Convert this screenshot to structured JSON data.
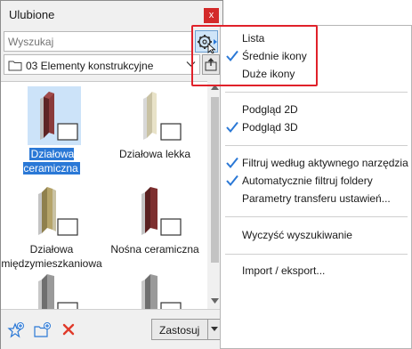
{
  "palette": {
    "title": "Ulubione",
    "close_glyph": "x",
    "search": {
      "placeholder": "Wyszukaj",
      "value": ""
    },
    "folder": {
      "selected": "03 Elementy konstrukcyjne"
    },
    "items": [
      {
        "label": "Działowa ceramiczna",
        "selected": true,
        "color": "#8a3b3b"
      },
      {
        "label": "Działowa lekka",
        "selected": false,
        "color": "#e8e2c8"
      },
      {
        "label": "Działowa międzymieszkaniowa",
        "label_line1": "Działowa",
        "label_line2": "międzymieszkaniowa",
        "selected": false,
        "color": "#b5a46a"
      },
      {
        "label": "Nośna ceramiczna",
        "selected": false,
        "color": "#7e2f2f"
      },
      {
        "label": "",
        "selected": false,
        "color": "#9a9a9a"
      },
      {
        "label": "",
        "selected": false,
        "color": "#9a9a9a"
      }
    ],
    "apply_label": "Zastosuj"
  },
  "menu": {
    "items": [
      {
        "label": "Lista",
        "checked": false
      },
      {
        "label": "Średnie ikony",
        "checked": true
      },
      {
        "label": "Duże ikony",
        "checked": false
      },
      {
        "label": "Podgląd 2D",
        "checked": false
      },
      {
        "label": "Podgląd 3D",
        "checked": true
      },
      {
        "label": "Filtruj według aktywnego narzędzia",
        "checked": true
      },
      {
        "label": "Automatycznie filtruj foldery",
        "checked": true
      },
      {
        "label": "Parametry transferu ustawień...",
        "checked": false
      },
      {
        "label": "Wyczyść wyszukiwanie",
        "checked": false
      },
      {
        "label": "Import / eksport...",
        "checked": false
      }
    ]
  },
  "colors": {
    "accent": "#2a78d6",
    "highlight": "#e0212a",
    "delete": "#e03a2a"
  }
}
